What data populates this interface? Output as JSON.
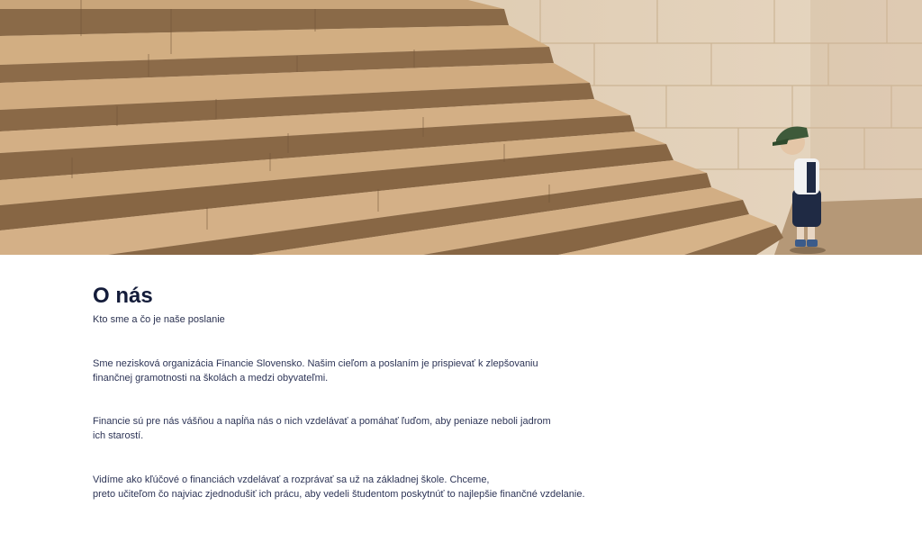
{
  "hero": {
    "image_description": "Stone staircase with a small child in a cap standing at the bottom right"
  },
  "about": {
    "title": "O nás",
    "subtitle": "Kto sme a čo je naše poslanie",
    "paragraphs": [
      {
        "lines": [
          "Sme nezisková organizácia Financie Slovensko. Našim cieľom a poslaním je prispievať k zlepšovaniu",
          "finančnej gramotnosti na školách a medzi obyvateľmi."
        ]
      },
      {
        "lines": [
          "Financie sú pre nás vášňou a napĺňa nás o nich vzdelávať a pomáhať ľuďom, aby peniaze neboli jadrom",
          "ich starostí."
        ]
      },
      {
        "lines": [
          "Vidíme ako kľúčové o financiách vzdelávať a rozprávať sa už na základnej škole. Chceme,",
          "preto učiteľom čo najviac zjednodušiť ich prácu, aby vedeli študentom poskytnúť to najlepšie finančné vzdelanie."
        ]
      }
    ]
  },
  "colors": {
    "title": "#141c3a",
    "text": "#2d3456",
    "background": "#ffffff"
  }
}
